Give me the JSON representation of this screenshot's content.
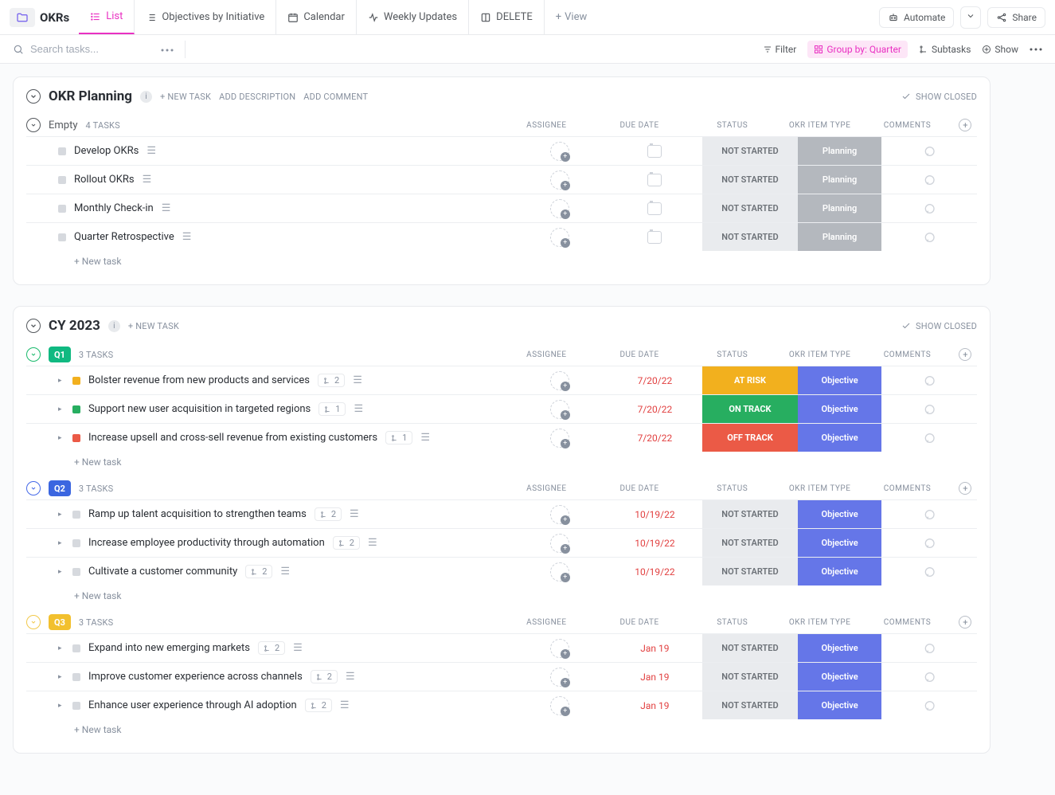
{
  "header": {
    "title": "OKRs",
    "views": [
      "List",
      "Objectives by Initiative",
      "Calendar",
      "Weekly Updates",
      "DELETE"
    ],
    "add_view": "View",
    "automate": "Automate",
    "share": "Share"
  },
  "toolbar": {
    "search_placeholder": "Search tasks...",
    "filter": "Filter",
    "group_by": "Group by: Quarter",
    "subtasks": "Subtasks",
    "show": "Show"
  },
  "columns": {
    "assignee": "ASSIGNEE",
    "due": "DUE DATE",
    "status": "STATUS",
    "type": "OKR ITEM TYPE",
    "comments": "COMMENTS"
  },
  "labels": {
    "new_task_action": "+ NEW TASK",
    "add_description": "ADD DESCRIPTION",
    "add_comment": "ADD COMMENT",
    "show_closed": "SHOW CLOSED",
    "new_task_row": "+ New task",
    "tasks_suffix": "TASKS"
  },
  "status": {
    "not_started": "NOT STARTED",
    "at_risk": "AT RISK",
    "on_track": "ON TRACK",
    "off_track": "OFF TRACK"
  },
  "type": {
    "planning": "Planning",
    "objective": "Objective"
  },
  "sections": [
    {
      "title": "OKR Planning",
      "groups": [
        {
          "name": "Empty",
          "count": "4",
          "rows": [
            {
              "name": "Develop OKRs"
            },
            {
              "name": "Rollout OKRs"
            },
            {
              "name": "Monthly Check-in"
            },
            {
              "name": "Quarter Retrospective"
            }
          ]
        }
      ]
    },
    {
      "title": "CY 2023",
      "groups": [
        {
          "name": "Q1",
          "count": "3",
          "rows": [
            {
              "name": "Bolster revenue from new products and services",
              "sub": "2",
              "due": "7/20/22",
              "status": "at_risk",
              "sq": "amber"
            },
            {
              "name": "Support new user acquisition in targeted regions",
              "sub": "1",
              "due": "7/20/22",
              "status": "on_track",
              "sq": "green"
            },
            {
              "name": "Increase upsell and cross-sell revenue from existing customers",
              "sub": "1",
              "due": "7/20/22",
              "status": "off_track",
              "sq": "red"
            }
          ]
        },
        {
          "name": "Q2",
          "count": "3",
          "rows": [
            {
              "name": "Ramp up talent acquisition to strengthen teams",
              "sub": "2",
              "due": "10/19/22"
            },
            {
              "name": "Increase employee productivity through automation",
              "sub": "2",
              "due": "10/19/22"
            },
            {
              "name": "Cultivate a customer community",
              "sub": "2",
              "due": "10/19/22"
            }
          ]
        },
        {
          "name": "Q3",
          "count": "3",
          "rows": [
            {
              "name": "Expand into new emerging markets",
              "sub": "2",
              "due": "Jan 19"
            },
            {
              "name": "Improve customer experience across channels",
              "sub": "2",
              "due": "Jan 19"
            },
            {
              "name": "Enhance user experience through AI adoption",
              "sub": "2",
              "due": "Jan 19"
            }
          ]
        }
      ]
    }
  ]
}
